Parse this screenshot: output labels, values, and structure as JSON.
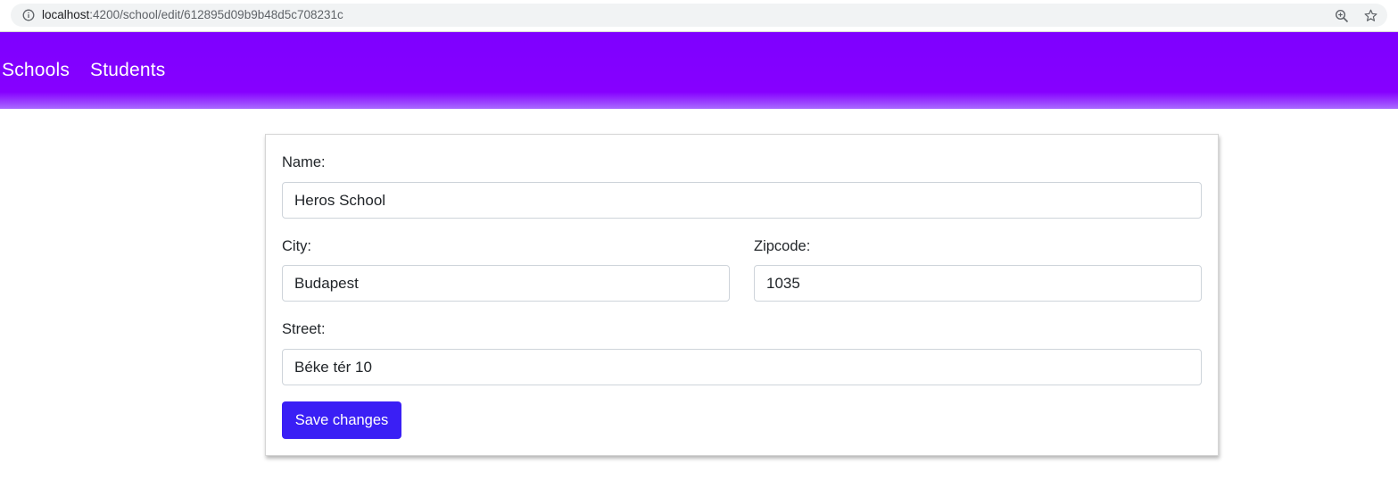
{
  "browser": {
    "url_host": "localhost",
    "url_path": ":4200/school/edit/612895d09b9b48d5c708231c",
    "icons": [
      "info-icon",
      "zoom-icon",
      "star-icon"
    ]
  },
  "navbar": {
    "links": [
      {
        "label": "Schools"
      },
      {
        "label": "Students"
      }
    ],
    "gradient_color": "#8600ff"
  },
  "form": {
    "name": {
      "label": "Name:",
      "value": "Heros School"
    },
    "city": {
      "label": "City:",
      "value": "Budapest"
    },
    "zipcode": {
      "label": "Zipcode:",
      "value": "1035"
    },
    "street": {
      "label": "Street:",
      "value": "Béke tér 10"
    },
    "save_label": "Save changes",
    "save_color": "#3a1ff5"
  }
}
